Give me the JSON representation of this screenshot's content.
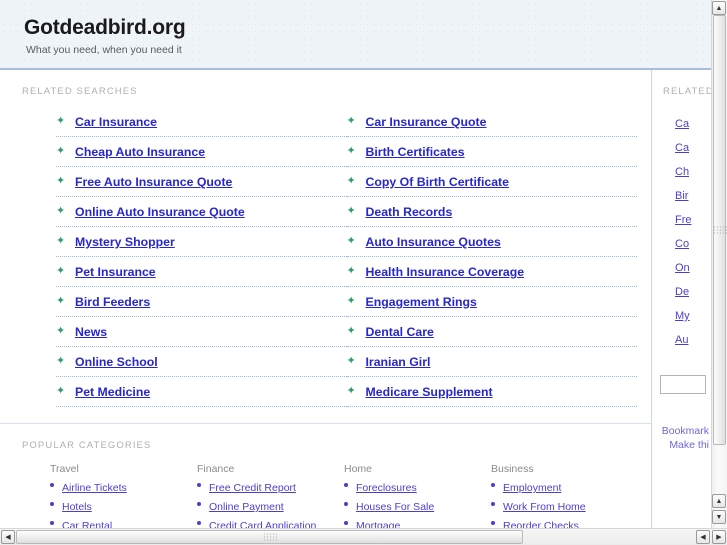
{
  "header": {
    "site_title": "Gotdeadbird.org",
    "tagline": "What you need, when you need it"
  },
  "main": {
    "related_label": "RELATED SEARCHES",
    "related_left": [
      "Car Insurance",
      "Cheap Auto Insurance",
      "Free Auto Insurance Quote",
      "Online Auto Insurance Quote",
      "Mystery Shopper",
      "Pet Insurance",
      "Bird Feeders",
      "News",
      "Online School",
      "Pet Medicine"
    ],
    "related_right": [
      "Car Insurance Quote",
      "Birth Certificates",
      "Copy Of Birth Certificate",
      "Death Records",
      "Auto Insurance Quotes",
      "Health Insurance Coverage",
      "Engagement Rings",
      "Dental Care",
      "Iranian Girl",
      "Medicare Supplement"
    ],
    "arrow_bullet": "✦"
  },
  "popular": {
    "label": "POPULAR CATEGORIES",
    "columns": [
      {
        "heading": "Travel",
        "items": [
          "Airline Tickets",
          "Hotels",
          "Car Rental"
        ]
      },
      {
        "heading": "Finance",
        "items": [
          "Free Credit Report",
          "Online Payment",
          "Credit Card Application"
        ]
      },
      {
        "heading": "Home",
        "items": [
          "Foreclosures",
          "Houses For Sale",
          "Mortgage"
        ]
      },
      {
        "heading": "Business",
        "items": [
          "Employment",
          "Work From Home",
          "Reorder Checks"
        ]
      }
    ]
  },
  "sidebar": {
    "label": "RELATED",
    "items": [
      "Ca",
      "Ca",
      "Ch",
      "Bir",
      "Fre",
      "Co",
      "On",
      "De",
      "My",
      "Au"
    ],
    "input_value": "",
    "footer_links": [
      "Bookmark",
      "Make thi"
    ]
  },
  "scrollbars": {
    "up_arrow": "▲",
    "down_arrow": "▼",
    "left_arrow": "◀",
    "right_arrow": "▶"
  },
  "colors": {
    "header_bg": "#eef4f8",
    "header_border": "#a8bede",
    "link_blue": "#2727cf",
    "cat_link": "#4b3fcf",
    "arrow_green": "#2f9e6e",
    "label_gray": "#b0b0b0",
    "dotted_sep": "#9fb6e0"
  }
}
